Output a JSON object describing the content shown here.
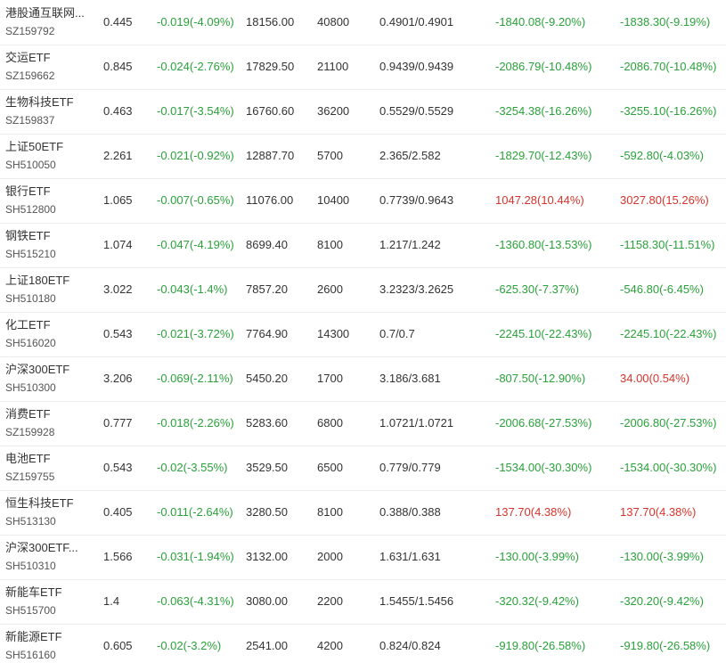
{
  "colors": {
    "gain": "#d6342b",
    "loss": "#2aa13a",
    "text": "#333333",
    "divider": "#ececec"
  },
  "rows": [
    {
      "name": "港股通互联网...",
      "code": "SZ159792",
      "price": "0.445",
      "change": "-0.019(-4.09%)",
      "change_dir": "neg",
      "market_value": "18156.00",
      "quantity": "40800",
      "cost": "0.4901/0.4901",
      "position_pl": "-1840.08(-9.20%)",
      "position_dir": "neg",
      "today_pl": "-1838.30(-9.19%)",
      "today_dir": "neg"
    },
    {
      "name": "交运ETF",
      "code": "SZ159662",
      "price": "0.845",
      "change": "-0.024(-2.76%)",
      "change_dir": "neg",
      "market_value": "17829.50",
      "quantity": "21100",
      "cost": "0.9439/0.9439",
      "position_pl": "-2086.79(-10.48%)",
      "position_dir": "neg",
      "today_pl": "-2086.70(-10.48%)",
      "today_dir": "neg"
    },
    {
      "name": "生物科技ETF",
      "code": "SZ159837",
      "price": "0.463",
      "change": "-0.017(-3.54%)",
      "change_dir": "neg",
      "market_value": "16760.60",
      "quantity": "36200",
      "cost": "0.5529/0.5529",
      "position_pl": "-3254.38(-16.26%)",
      "position_dir": "neg",
      "today_pl": "-3255.10(-16.26%)",
      "today_dir": "neg"
    },
    {
      "name": "上证50ETF",
      "code": "SH510050",
      "price": "2.261",
      "change": "-0.021(-0.92%)",
      "change_dir": "neg",
      "market_value": "12887.70",
      "quantity": "5700",
      "cost": "2.365/2.582",
      "position_pl": "-1829.70(-12.43%)",
      "position_dir": "neg",
      "today_pl": "-592.80(-4.03%)",
      "today_dir": "neg"
    },
    {
      "name": "银行ETF",
      "code": "SH512800",
      "price": "1.065",
      "change": "-0.007(-0.65%)",
      "change_dir": "neg",
      "market_value": "11076.00",
      "quantity": "10400",
      "cost": "0.7739/0.9643",
      "position_pl": "1047.28(10.44%)",
      "position_dir": "pos",
      "today_pl": "3027.80(15.26%)",
      "today_dir": "pos"
    },
    {
      "name": "钢铁ETF",
      "code": "SH515210",
      "price": "1.074",
      "change": "-0.047(-4.19%)",
      "change_dir": "neg",
      "market_value": "8699.40",
      "quantity": "8100",
      "cost": "1.217/1.242",
      "position_pl": "-1360.80(-13.53%)",
      "position_dir": "neg",
      "today_pl": "-1158.30(-11.51%)",
      "today_dir": "neg"
    },
    {
      "name": "上证180ETF",
      "code": "SH510180",
      "price": "3.022",
      "change": "-0.043(-1.4%)",
      "change_dir": "neg",
      "market_value": "7857.20",
      "quantity": "2600",
      "cost": "3.2323/3.2625",
      "position_pl": "-625.30(-7.37%)",
      "position_dir": "neg",
      "today_pl": "-546.80(-6.45%)",
      "today_dir": "neg"
    },
    {
      "name": "化工ETF",
      "code": "SH516020",
      "price": "0.543",
      "change": "-0.021(-3.72%)",
      "change_dir": "neg",
      "market_value": "7764.90",
      "quantity": "14300",
      "cost": "0.7/0.7",
      "position_pl": "-2245.10(-22.43%)",
      "position_dir": "neg",
      "today_pl": "-2245.10(-22.43%)",
      "today_dir": "neg"
    },
    {
      "name": "沪深300ETF",
      "code": "SH510300",
      "price": "3.206",
      "change": "-0.069(-2.11%)",
      "change_dir": "neg",
      "market_value": "5450.20",
      "quantity": "1700",
      "cost": "3.186/3.681",
      "position_pl": "-807.50(-12.90%)",
      "position_dir": "neg",
      "today_pl": "34.00(0.54%)",
      "today_dir": "pos"
    },
    {
      "name": "消费ETF",
      "code": "SZ159928",
      "price": "0.777",
      "change": "-0.018(-2.26%)",
      "change_dir": "neg",
      "market_value": "5283.60",
      "quantity": "6800",
      "cost": "1.0721/1.0721",
      "position_pl": "-2006.68(-27.53%)",
      "position_dir": "neg",
      "today_pl": "-2006.80(-27.53%)",
      "today_dir": "neg"
    },
    {
      "name": "电池ETF",
      "code": "SZ159755",
      "price": "0.543",
      "change": "-0.02(-3.55%)",
      "change_dir": "neg",
      "market_value": "3529.50",
      "quantity": "6500",
      "cost": "0.779/0.779",
      "position_pl": "-1534.00(-30.30%)",
      "position_dir": "neg",
      "today_pl": "-1534.00(-30.30%)",
      "today_dir": "neg"
    },
    {
      "name": "恒生科技ETF",
      "code": "SH513130",
      "price": "0.405",
      "change": "-0.011(-2.64%)",
      "change_dir": "neg",
      "market_value": "3280.50",
      "quantity": "8100",
      "cost": "0.388/0.388",
      "position_pl": "137.70(4.38%)",
      "position_dir": "pos",
      "today_pl": "137.70(4.38%)",
      "today_dir": "pos"
    },
    {
      "name": "沪深300ETF...",
      "code": "SH510310",
      "price": "1.566",
      "change": "-0.031(-1.94%)",
      "change_dir": "neg",
      "market_value": "3132.00",
      "quantity": "2000",
      "cost": "1.631/1.631",
      "position_pl": "-130.00(-3.99%)",
      "position_dir": "neg",
      "today_pl": "-130.00(-3.99%)",
      "today_dir": "neg"
    },
    {
      "name": "新能车ETF",
      "code": "SH515700",
      "price": "1.4",
      "change": "-0.063(-4.31%)",
      "change_dir": "neg",
      "market_value": "3080.00",
      "quantity": "2200",
      "cost": "1.5455/1.5456",
      "position_pl": "-320.32(-9.42%)",
      "position_dir": "neg",
      "today_pl": "-320.20(-9.42%)",
      "today_dir": "neg"
    },
    {
      "name": "新能源ETF",
      "code": "SH516160",
      "price": "0.605",
      "change": "-0.02(-3.2%)",
      "change_dir": "neg",
      "market_value": "2541.00",
      "quantity": "4200",
      "cost": "0.824/0.824",
      "position_pl": "-919.80(-26.58%)",
      "position_dir": "neg",
      "today_pl": "-919.80(-26.58%)",
      "today_dir": "neg"
    }
  ]
}
